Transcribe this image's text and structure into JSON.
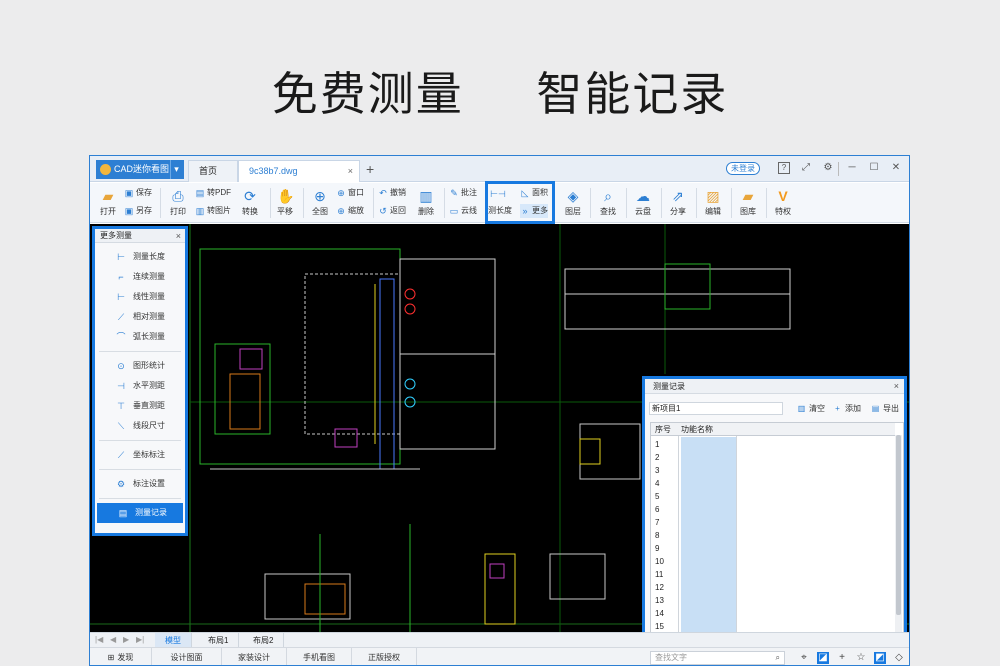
{
  "headline": {
    "left": "免费测量",
    "right": "智能记录"
  },
  "titlebar": {
    "app_name": "CAD迷你看图",
    "tab_home": "首页",
    "tab_file": "9c38b7.dwg",
    "tab_close": "×",
    "add_tab": "+",
    "login": "未登录",
    "help": "?",
    "fullscreen": "⤢",
    "settings": "⚙",
    "minimize": "─",
    "maximize": "☐",
    "close": "✕"
  },
  "ribbon": {
    "open": "打开",
    "save": "保存",
    "save_as": "另存",
    "print": "打印",
    "to_pdf": "转PDF",
    "to_image": "转图片",
    "convert": "转换",
    "pan": "平移",
    "full_view": "全图",
    "window": "窗口",
    "zoom": "缩放",
    "undo": "撤销",
    "back": "返回",
    "delete": "删除",
    "annotate": "批注",
    "cloud_line": "云线",
    "measure_length": "测长度",
    "area": "面积",
    "more": "更多",
    "layers": "图层",
    "find": "查找",
    "cloud_disk": "云盘",
    "share": "分享",
    "edit": "编辑",
    "library": "图库",
    "privilege": "特权",
    "tooltip": "更多"
  },
  "left_panel": {
    "title": "更多测量",
    "close": "×",
    "items": [
      {
        "label": "测量长度",
        "icon": "ruler-icon"
      },
      {
        "label": "连续测量",
        "icon": "continuous-icon"
      },
      {
        "label": "线性测量",
        "icon": "linear-icon"
      },
      {
        "label": "相对测量",
        "icon": "relative-icon"
      },
      {
        "label": "弧长测量",
        "icon": "arc-icon"
      },
      {
        "label": "图形统计",
        "icon": "stats-icon"
      },
      {
        "label": "水平测距",
        "icon": "horizontal-icon"
      },
      {
        "label": "垂直测距",
        "icon": "vertical-icon"
      },
      {
        "label": "线段尺寸",
        "icon": "segment-icon"
      },
      {
        "label": "坐标标注",
        "icon": "coordinate-icon"
      },
      {
        "label": "标注设置",
        "icon": "gear-icon"
      },
      {
        "label": "测量记录",
        "icon": "record-icon"
      }
    ]
  },
  "right_panel": {
    "title": "测量记录",
    "close": "×",
    "project_name": "新项目1",
    "clear": "清空",
    "add": "添加",
    "export": "导出",
    "col_index": "序号",
    "col_name": "功能名称",
    "rows": [
      "1",
      "2",
      "3",
      "4",
      "5",
      "6",
      "7",
      "8",
      "9",
      "10",
      "11",
      "12",
      "13",
      "14",
      "15"
    ]
  },
  "sheets": {
    "model": "模型",
    "layout1": "布局1",
    "layout2": "布局2"
  },
  "statusbar": {
    "publish": "发现",
    "design_drawing": "设计图面",
    "decor_design": "家装设计",
    "mobile_view": "手机看图",
    "license": "正版授权",
    "search_placeholder": "查找文字"
  },
  "colors": {
    "accent": "#1779e0",
    "canvas": "#000000"
  }
}
